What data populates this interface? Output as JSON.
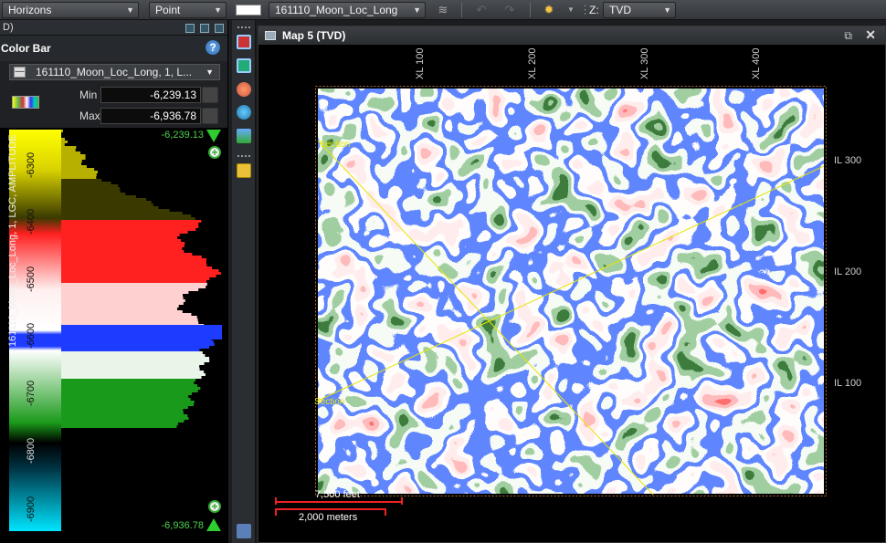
{
  "toolbar": {
    "horizons_combo": "Horizons",
    "mode_combo": "Point",
    "horizon_combo": "161110_Moon_Loc_Long",
    "z_label": "Z:",
    "domain_combo": "TVD"
  },
  "left_panel": {
    "tab_label": "D)",
    "title": "Color Bar",
    "horizon_select": "161110_Moon_Loc_Long, 1, L...",
    "min_label": "Min",
    "min_value": "-6,239.13",
    "max_label": "Max",
    "max_value": "-6,936.78",
    "top_value": "-6,239.13",
    "bottom_value": "-6,936.78",
    "axis_label": "161110_Moon_Loc_Long, 1, LGC, AMPLITUDE",
    "y_ticks": [
      "-6300",
      "-6400",
      "-6500",
      "-6600",
      "-6700",
      "-6800",
      "-6900"
    ]
  },
  "map": {
    "title": "Map 5 (TVD)",
    "xl_ticks": [
      "XL 100",
      "XL 200",
      "XL 300",
      "XL 400"
    ],
    "il_ticks": [
      "IL 300",
      "IL 200",
      "IL 100"
    ],
    "section_labels": [
      "Section",
      "Section"
    ],
    "scale_feet": "7,500 feet",
    "scale_meters": "2,000 meters"
  },
  "colors": {
    "accent_green": "#2ecc2e",
    "map_red": "#ff2a2a",
    "map_blue": "#1e3cff",
    "map_green": "#3f9a3f",
    "map_olive": "#4b4a0a"
  }
}
